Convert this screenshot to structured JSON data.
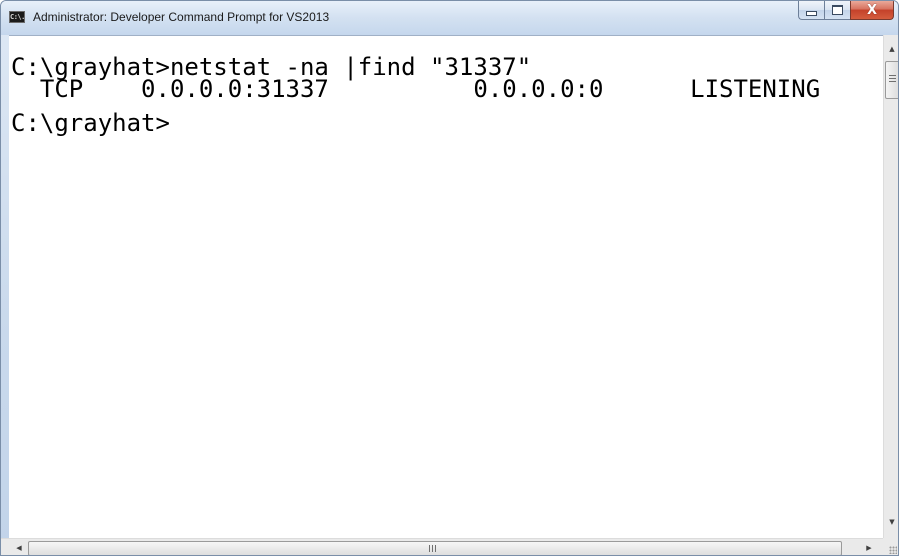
{
  "window": {
    "title": "Administrator: Developer Command Prompt for VS2013",
    "app_icon_label": "C:\\."
  },
  "caption_buttons": {
    "minimize_icon": "minimize-icon",
    "maximize_icon": "maximize-icon",
    "close_glyph": "X"
  },
  "console": {
    "lines": [
      "C:\\grayhat>netstat -na |find \"31337\"",
      "  TCP    0.0.0.0:31337          0.0.0.0:0      LISTENING",
      "C:\\grayhat>"
    ]
  },
  "scrollbars": {
    "vertical": {
      "up_glyph": "▲",
      "down_glyph": "▼"
    },
    "horizontal": {
      "left_glyph": "◀",
      "right_glyph": "▶"
    }
  },
  "colors": {
    "console_background": "#ffffff",
    "console_text": "#000000",
    "close_button": "#c4422a"
  }
}
